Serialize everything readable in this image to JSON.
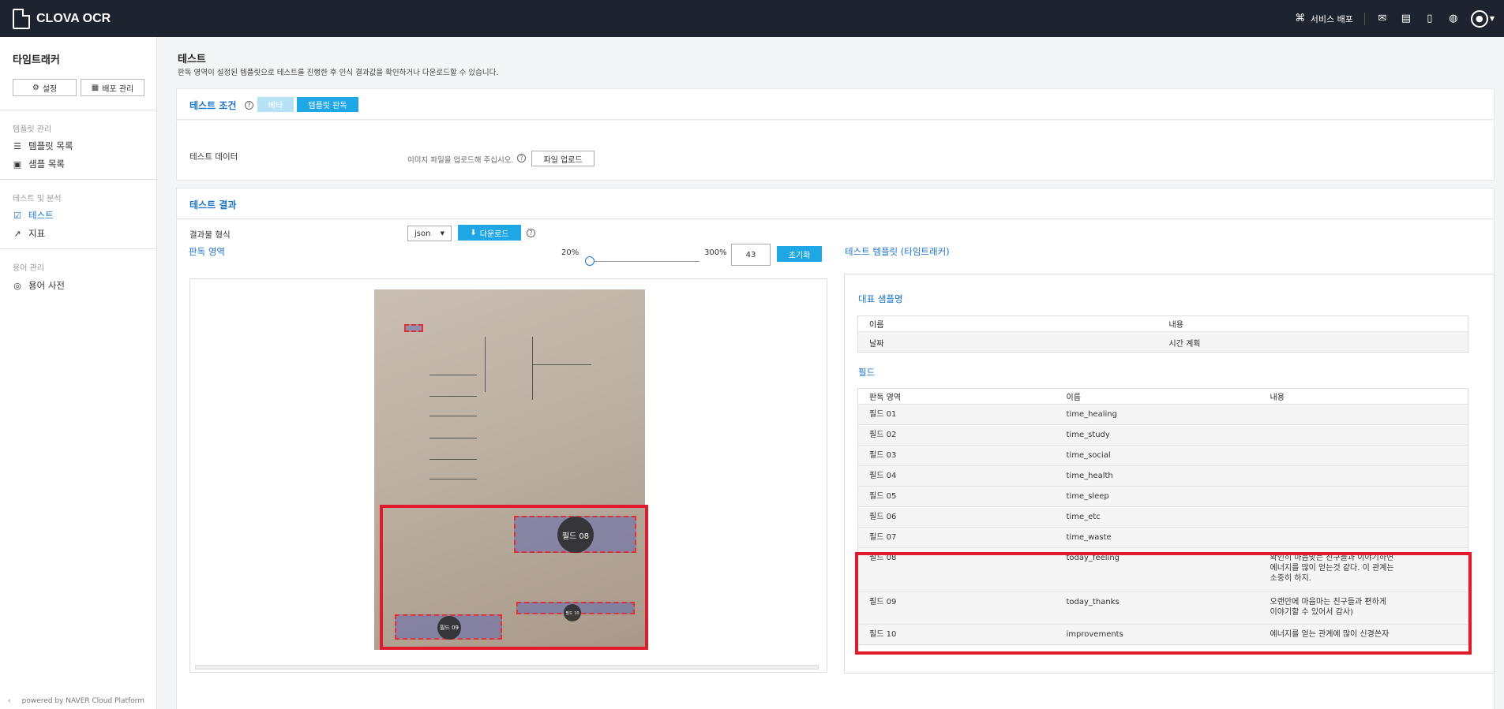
{
  "app": {
    "logo": "CLOVA OCR"
  },
  "topbar": {
    "service_deploy": "서비스 배포"
  },
  "sidebar": {
    "title": "타임트래커",
    "settings_btn": "설정",
    "deploy_btn": "배포 관리",
    "sections": [
      {
        "label": "템플릿 관리",
        "items": [
          "템플릿 목록",
          "샘플 목록"
        ]
      },
      {
        "label": "테스트 및 분석",
        "items": [
          "테스트",
          "지표"
        ]
      },
      {
        "label": "용어 관리",
        "items": [
          "용어 사전"
        ]
      }
    ],
    "footer": "powered by NAVER Cloud Platform"
  },
  "page": {
    "title": "테스트",
    "desc": "판독 영역이 설정된 템플릿으로 테스트를 진행한 후 인식 결과값을 확인하거나 다운로드할 수 있습니다."
  },
  "conditions": {
    "title": "테스트 조건",
    "tab_beta": "베타",
    "tab_template": "템플릿 판독",
    "data_label": "테스트 데이터",
    "upload_hint": "이미지 파일을 업로드해 주십시오.",
    "upload_btn": "파일 업로드"
  },
  "results": {
    "title": "테스트 결과",
    "format_label": "결과물 형식",
    "format_value": "json",
    "download_btn": "다운로드",
    "area_title": "판독 영역",
    "zoom_min": "20%",
    "zoom_max": "300%",
    "zoom_value": "43",
    "reset_btn": "초기화",
    "template_title": "테스트 템플릿 (타임트래커)"
  },
  "zones": {
    "f08": "필드 08",
    "f09": "필드 09",
    "f10": "필드 10"
  },
  "rep": {
    "title": "대표 샘플명",
    "headers": [
      "이름",
      "내용"
    ],
    "row": [
      "날짜",
      "시간 계획"
    ]
  },
  "fields": {
    "title": "필드",
    "headers": [
      "판독 영역",
      "이름",
      "내용"
    ],
    "rows": [
      [
        "필드 01",
        "time_healing",
        ""
      ],
      [
        "필드 02",
        "time_study",
        ""
      ],
      [
        "필드 03",
        "time_social",
        ""
      ],
      [
        "필드 04",
        "time_health",
        ""
      ],
      [
        "필드 05",
        "time_sleep",
        ""
      ],
      [
        "필드 06",
        "time_etc",
        ""
      ],
      [
        "필드 07",
        "time_waste",
        ""
      ],
      [
        "필드 08",
        "today_feeling",
        "확인히 마음맞는 친구들과 이야기하면\n에너지를 많이 얻는것 같다. 이 관계는\n소중히 하지."
      ],
      [
        "필드 09",
        "today_thanks",
        "오랜만에 마음마는 친구들과 편하게\n이야기할 수 있어서 감사)"
      ],
      [
        "필드 10",
        "improvements",
        "에너지를 얻는 관계에 많이 신경쓴자"
      ]
    ]
  },
  "colors": {
    "accent": "#1a73c9",
    "button": "#1fa7e5",
    "highlight": "#e01c2c"
  }
}
